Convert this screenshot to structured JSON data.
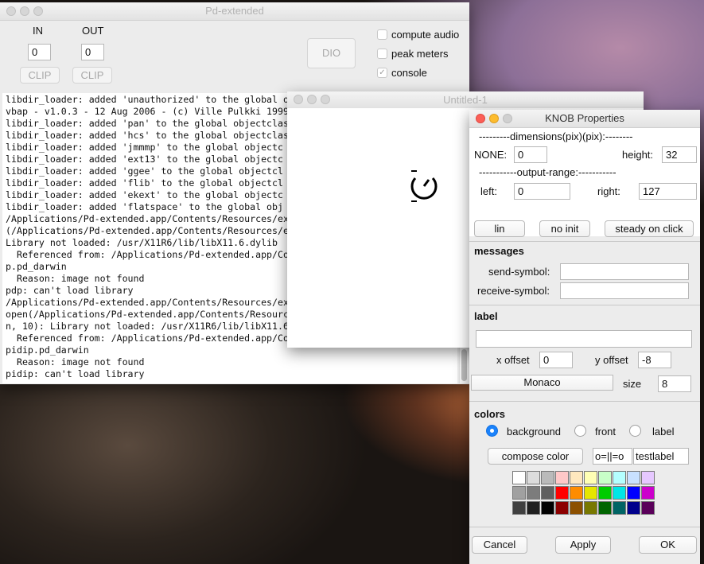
{
  "pd_window": {
    "title": "Pd-extended",
    "in_label": "IN",
    "out_label": "OUT",
    "in_value": "0",
    "out_value": "0",
    "clip_in": "CLIP",
    "clip_out": "CLIP",
    "dio": "DIO",
    "compute_audio": "compute audio",
    "peak_meters": "peak meters",
    "console": "console",
    "console_checked": "✓",
    "console_lines": [
      "libdir_loader: added 'unauthorized' to the global o",
      "vbap - v1.0.3 - 12 Aug 2006 - (c) Ville Pulkki 1999",
      "libdir_loader: added 'pan' to the global objectclas",
      "libdir_loader: added 'hcs' to the global objectclas",
      "libdir_loader: added 'jmmmp' to the global objectc",
      "libdir_loader: added 'ext13' to the global objectc",
      "libdir_loader: added 'ggee' to the global objectcl",
      "libdir_loader: added 'flib' to the global objectcl",
      "libdir_loader: added 'ekext' to the global objectc",
      "libdir_loader: added 'flatspace' to the global obj",
      "/Applications/Pd-extended.app/Contents/Resources/ex",
      "(/Applications/Pd-extended.app/Contents/Resources/e",
      "Library not loaded: /usr/X11R6/lib/libX11.6.dylib",
      "  Referenced from: /Applications/Pd-extended.app/Co",
      "p.pd_darwin",
      "  Reason: image not found",
      "pdp: can't load library",
      "/Applications/Pd-extended.app/Contents/Resources/ex",
      "open(/Applications/Pd-extended.app/Contents/Resourc",
      "n, 10): Library not loaded: /usr/X11R6/lib/libX11.6",
      "  Referenced from: /Applications/Pd-extended.app/Co",
      "pidip.pd_darwin",
      "  Reason: image not found",
      "pidip: can't load library"
    ]
  },
  "patch_window": {
    "title": "Untitled-1"
  },
  "knob": {
    "title": "KNOB Properties",
    "dimensions_header": "---------dimensions(pix)(pix):--------",
    "none_label": "NONE:",
    "none_value": "0",
    "height_label": "height:",
    "height_value": "32",
    "output_header": "-----------output-range:-----------",
    "left_label": "left:",
    "left_value": "0",
    "right_label": "right:",
    "right_value": "127",
    "lin": "lin",
    "no_init": "no init",
    "steady": "steady on click",
    "messages": "messages",
    "send_label": "send-symbol:",
    "send_value": "",
    "receive_label": "receive-symbol:",
    "receive_value": "",
    "label_header": "label",
    "label_value": "",
    "x_offset_label": "x offset",
    "x_offset_value": "0",
    "y_offset_label": "y offset",
    "y_offset_value": "-8",
    "font": "Monaco",
    "size_label": "size",
    "size_value": "8",
    "colors": "colors",
    "background": "background",
    "front": "front",
    "label_radio": "label",
    "compose": "compose color",
    "preview_knob": "o=||=o",
    "preview_label": "testlabel",
    "swatches": [
      [
        "#ffffff",
        "#dcdcdc",
        "#bababa",
        "#ffc8c8",
        "#ffe8be",
        "#ffffb4",
        "#c8ffc8",
        "#b4ffff",
        "#c8e0ff",
        "#e6c8ff"
      ],
      [
        "#a0a0a0",
        "#7c7c7c",
        "#606060",
        "#ff0000",
        "#ff8c00",
        "#e6e600",
        "#00cc00",
        "#00e6e6",
        "#0000ff",
        "#cc00cc"
      ],
      [
        "#404040",
        "#202020",
        "#000000",
        "#8c0000",
        "#8c5000",
        "#787800",
        "#006400",
        "#006464",
        "#00008c",
        "#5a005a"
      ]
    ],
    "cancel": "Cancel",
    "apply": "Apply",
    "ok": "OK"
  }
}
